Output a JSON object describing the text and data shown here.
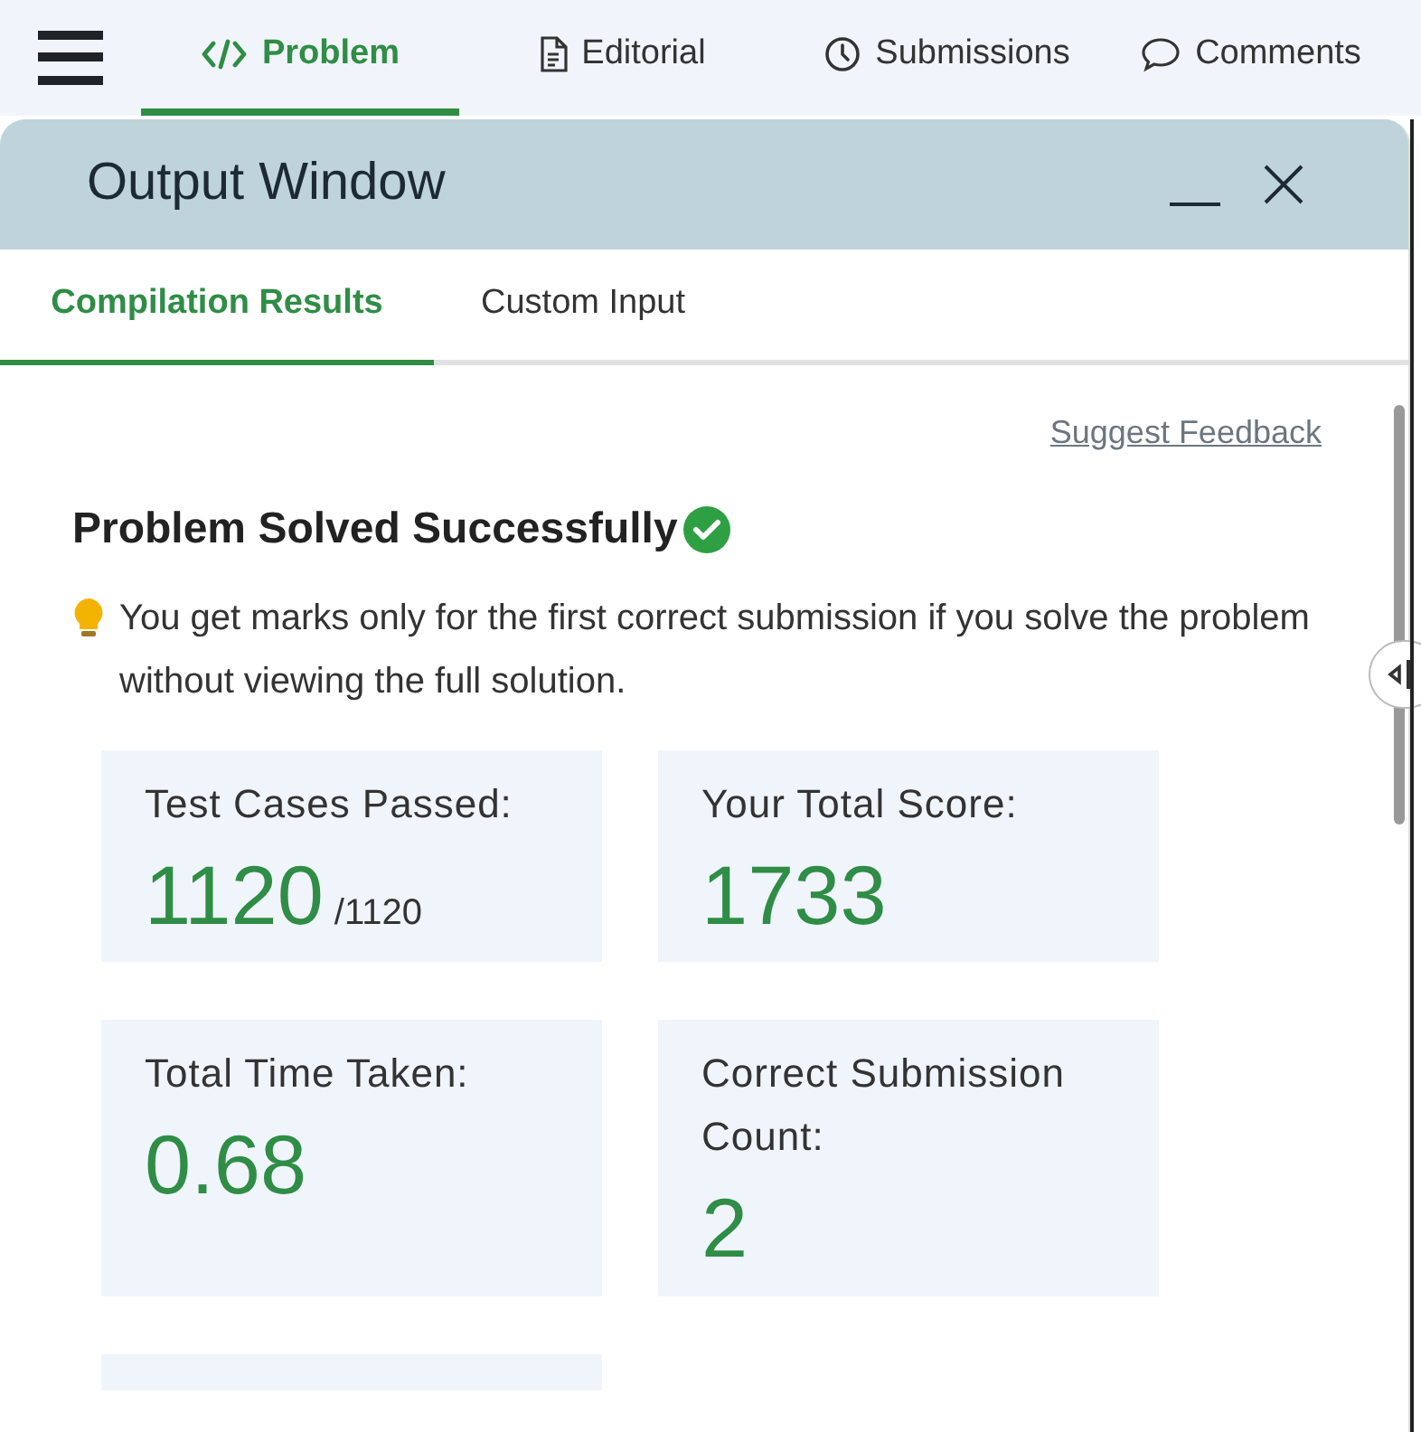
{
  "nav": {
    "tabs": [
      {
        "label": "Problem",
        "selected": true
      },
      {
        "label": "Editorial",
        "selected": false
      },
      {
        "label": "Submissions",
        "selected": false
      },
      {
        "label": "Comments",
        "selected": false
      }
    ]
  },
  "output_window": {
    "title": "Output Window",
    "tabs": [
      {
        "label": "Compilation Results",
        "selected": true
      },
      {
        "label": "Custom Input",
        "selected": false
      }
    ],
    "feedback_link": "Suggest Feedback",
    "status": "Problem Solved Successfully",
    "note": "You get marks only for the first correct submission if you solve the problem without viewing the full solution.",
    "stats": [
      {
        "label": "Test Cases Passed:",
        "value": "1120",
        "suffix": "/1120"
      },
      {
        "label": "Your Total Score:",
        "value": "1733"
      },
      {
        "label": "Total Time Taken:",
        "value": "0.68"
      },
      {
        "label": "Correct Submission Count:",
        "value": "2"
      },
      {
        "kind": "cut"
      }
    ]
  }
}
